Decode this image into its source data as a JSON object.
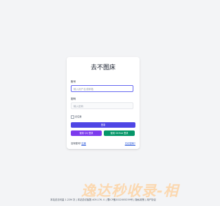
{
  "login": {
    "title": "去不图床",
    "account_label": "账号",
    "account_placeholder": "输入用户名或邮箱",
    "password_label": "密码",
    "password_placeholder": "输入密码",
    "remember_label": "记住我",
    "login_button": "登录",
    "qq_login_button": "使用 QQ 登录",
    "github_login_button": "使用 GitHub 登录",
    "no_account_text": "没有账号?",
    "register_link": "注册",
    "forgot_password_link": "忘记密码?"
  },
  "watermark": "逸达秒收录-",
  "watermark_tail": "相",
  "footer": {
    "text": "本站总访问量 1.22M 次 | 本站总访客数 405.17K 人 | 蜀ICP备2022005259号 | 隐私政策 | 用户协议"
  },
  "colors": {
    "page_bg": "#f3f4f6",
    "primary": "#4f46e5",
    "qq": "#7c3aed",
    "github": "#059669"
  }
}
